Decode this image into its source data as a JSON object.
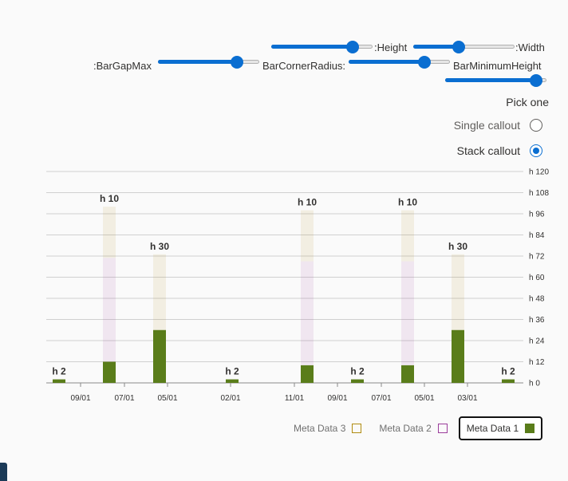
{
  "controls": {
    "height_label": ":Height",
    "width_label": ":Width",
    "bar_gap_max_label": ":BarGapMax",
    "bar_corner_radius_label": "BarCornerRadius:",
    "bar_min_height_label": "BarMinimumHeight",
    "height_value": 0.8,
    "width_value": 0.45,
    "bar_gap_max_value": 0.78,
    "bar_corner_radius_value": 0.75,
    "bar_min_height_value": 0.9
  },
  "callout": {
    "group_label": "Pick one",
    "options": [
      {
        "label": "Single callout",
        "checked": false
      },
      {
        "label": "Stack callout",
        "checked": true
      }
    ]
  },
  "chart_data": {
    "type": "bar",
    "stacked": true,
    "title": "",
    "ylim": [
      0,
      120
    ],
    "y_ticks": [
      "h 0",
      "h 12",
      "h 24",
      "h 36",
      "h 48",
      "h 60",
      "h 72",
      "h 84",
      "h 96",
      "h 108",
      "h 120"
    ],
    "x_tick_labels": [
      "09/01",
      "07/01",
      "05/01",
      "02/01",
      "11/01",
      "09/01",
      "07/01",
      "05/01",
      "03/01"
    ],
    "bar_labels": [
      "h 2",
      "h 10",
      "h 30",
      "h 2",
      "h 10",
      "h 2",
      "h 10",
      "h 30",
      "h 2"
    ],
    "series": [
      {
        "name": "Meta Data 1",
        "color": "#5a7d1a",
        "values": [
          2,
          12,
          30,
          2,
          10,
          2,
          10,
          30,
          2
        ]
      },
      {
        "name": "Meta Data 2",
        "color": "#9b3c9b",
        "values": [
          0,
          59,
          0,
          0,
          59,
          0,
          59,
          0,
          0
        ]
      },
      {
        "name": "Meta Data 3",
        "color": "#b08b10",
        "values": [
          0,
          29,
          43,
          0,
          29,
          0,
          29,
          43,
          0
        ]
      }
    ],
    "active_series": "Meta Data 1",
    "grid": true,
    "y_axis_side": "right",
    "legend_position": "bottom-right"
  }
}
